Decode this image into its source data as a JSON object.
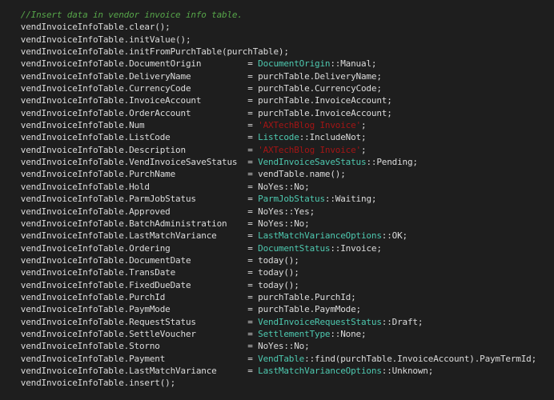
{
  "editor": {
    "background": "#1e1e1e",
    "colors": {
      "comment": "#57a64a",
      "plain": "#dcdcdc",
      "type": "#4ec9b0",
      "string": "#a31515"
    },
    "lines": [
      {
        "indent": "    ",
        "tokens": [
          {
            "type": "comment",
            "text": "//Insert data in vendor invoice info table."
          }
        ]
      },
      {
        "indent": "    ",
        "tokens": [
          {
            "type": "plain",
            "text": "vendInvoiceInfoTable.clear();"
          }
        ]
      },
      {
        "indent": "    ",
        "tokens": [
          {
            "type": "plain",
            "text": "vendInvoiceInfoTable.initValue();"
          }
        ]
      },
      {
        "indent": "    ",
        "tokens": [
          {
            "type": "plain",
            "text": "vendInvoiceInfoTable.initFromPurchTable(purchTable);"
          }
        ]
      },
      {
        "indent": "    ",
        "tokens": [
          {
            "type": "plain",
            "text": "vendInvoiceInfoTable.DocumentOrigin         = "
          },
          {
            "type": "type",
            "text": "DocumentOrigin"
          },
          {
            "type": "plain",
            "text": "::Manual;"
          }
        ]
      },
      {
        "indent": "    ",
        "tokens": [
          {
            "type": "plain",
            "text": "vendInvoiceInfoTable.DeliveryName           = purchTable.DeliveryName;"
          }
        ]
      },
      {
        "indent": "    ",
        "tokens": [
          {
            "type": "plain",
            "text": "vendInvoiceInfoTable.CurrencyCode           = purchTable.CurrencyCode;"
          }
        ]
      },
      {
        "indent": "    ",
        "tokens": [
          {
            "type": "plain",
            "text": "vendInvoiceInfoTable.InvoiceAccount         = purchTable.InvoiceAccount;"
          }
        ]
      },
      {
        "indent": "    ",
        "tokens": [
          {
            "type": "plain",
            "text": "vendInvoiceInfoTable.OrderAccount           = purchTable.InvoiceAccount;"
          }
        ]
      },
      {
        "indent": "    ",
        "tokens": [
          {
            "type": "plain",
            "text": "vendInvoiceInfoTable.Num                    = "
          },
          {
            "type": "string",
            "text": "'AXTechBlog Invoice'"
          },
          {
            "type": "plain",
            "text": ";"
          }
        ]
      },
      {
        "indent": "    ",
        "tokens": [
          {
            "type": "plain",
            "text": "vendInvoiceInfoTable.ListCode               = "
          },
          {
            "type": "type",
            "text": "Listcode"
          },
          {
            "type": "plain",
            "text": "::IncludeNot;"
          }
        ]
      },
      {
        "indent": "    ",
        "tokens": [
          {
            "type": "plain",
            "text": "vendInvoiceInfoTable.Description            = "
          },
          {
            "type": "string",
            "text": "'AXTechBlog Invoice'"
          },
          {
            "type": "plain",
            "text": ";"
          }
        ]
      },
      {
        "indent": "    ",
        "tokens": [
          {
            "type": "plain",
            "text": "vendInvoiceInfoTable.VendInvoiceSaveStatus  = "
          },
          {
            "type": "type",
            "text": "VendInvoiceSaveStatus"
          },
          {
            "type": "plain",
            "text": "::Pending;"
          }
        ]
      },
      {
        "indent": "    ",
        "tokens": [
          {
            "type": "plain",
            "text": "vendInvoiceInfoTable.PurchName              = vendTable.name();"
          }
        ]
      },
      {
        "indent": "    ",
        "tokens": [
          {
            "type": "plain",
            "text": "vendInvoiceInfoTable.Hold                   = NoYes::No;"
          }
        ]
      },
      {
        "indent": "    ",
        "tokens": [
          {
            "type": "plain",
            "text": "vendInvoiceInfoTable.ParmJobStatus          = "
          },
          {
            "type": "type",
            "text": "ParmJobStatus"
          },
          {
            "type": "plain",
            "text": "::Waiting;"
          }
        ]
      },
      {
        "indent": "    ",
        "tokens": [
          {
            "type": "plain",
            "text": "vendInvoiceInfoTable.Approved               = NoYes::Yes;"
          }
        ]
      },
      {
        "indent": "    ",
        "tokens": [
          {
            "type": "plain",
            "text": "vendInvoiceInfoTable.BatchAdministration    = NoYes::No;"
          }
        ]
      },
      {
        "indent": "    ",
        "tokens": [
          {
            "type": "plain",
            "text": "vendInvoiceInfoTable.LastMatchVariance      = "
          },
          {
            "type": "type",
            "text": "LastMatchVarianceOptions"
          },
          {
            "type": "plain",
            "text": "::OK;"
          }
        ]
      },
      {
        "indent": "    ",
        "tokens": [
          {
            "type": "plain",
            "text": "vendInvoiceInfoTable.Ordering               = "
          },
          {
            "type": "type",
            "text": "DocumentStatus"
          },
          {
            "type": "plain",
            "text": "::Invoice;"
          }
        ]
      },
      {
        "indent": "    ",
        "tokens": [
          {
            "type": "plain",
            "text": "vendInvoiceInfoTable.DocumentDate           = today();"
          }
        ]
      },
      {
        "indent": "    ",
        "tokens": [
          {
            "type": "plain",
            "text": "vendInvoiceInfoTable.TransDate              = today();"
          }
        ]
      },
      {
        "indent": "    ",
        "tokens": [
          {
            "type": "plain",
            "text": "vendInvoiceInfoTable.FixedDueDate           = today();"
          }
        ]
      },
      {
        "indent": "    ",
        "tokens": [
          {
            "type": "plain",
            "text": "vendInvoiceInfoTable.PurchId                = purchTable.PurchId;"
          }
        ]
      },
      {
        "indent": "    ",
        "tokens": [
          {
            "type": "plain",
            "text": "vendInvoiceInfoTable.PaymMode               = purchTable.PaymMode;"
          }
        ]
      },
      {
        "indent": "    ",
        "tokens": [
          {
            "type": "plain",
            "text": "vendInvoiceInfoTable.RequestStatus          = "
          },
          {
            "type": "type",
            "text": "VendInvoiceRequestStatus"
          },
          {
            "type": "plain",
            "text": "::Draft;"
          }
        ]
      },
      {
        "indent": "    ",
        "tokens": [
          {
            "type": "plain",
            "text": "vendInvoiceInfoTable.SettleVoucher          = "
          },
          {
            "type": "type",
            "text": "SettlementType"
          },
          {
            "type": "plain",
            "text": "::None;"
          }
        ]
      },
      {
        "indent": "    ",
        "tokens": [
          {
            "type": "plain",
            "text": "vendInvoiceInfoTable.Storno                 = NoYes::No;"
          }
        ]
      },
      {
        "indent": "    ",
        "tokens": [
          {
            "type": "plain",
            "text": "vendInvoiceInfoTable.Payment                = "
          },
          {
            "type": "type",
            "text": "VendTable"
          },
          {
            "type": "plain",
            "text": "::find(purchTable.InvoiceAccount).PaymTermId;"
          }
        ]
      },
      {
        "indent": "    ",
        "tokens": [
          {
            "type": "plain",
            "text": "vendInvoiceInfoTable.LastMatchVariance      = "
          },
          {
            "type": "type",
            "text": "LastMatchVarianceOptions"
          },
          {
            "type": "plain",
            "text": "::Unknown;"
          }
        ]
      },
      {
        "indent": "    ",
        "tokens": [
          {
            "type": "plain",
            "text": "vendInvoiceInfoTable.insert();"
          }
        ]
      }
    ]
  }
}
